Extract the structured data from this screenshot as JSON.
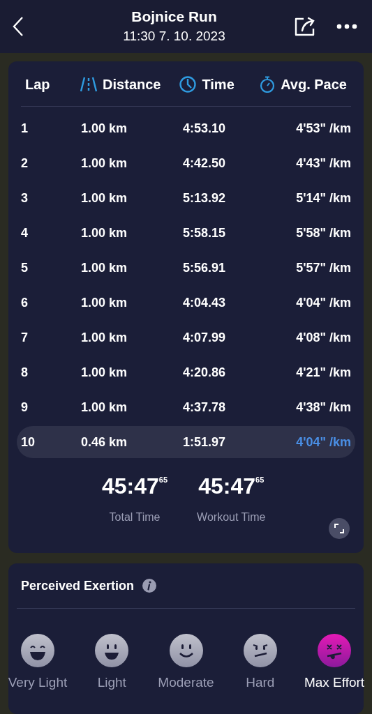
{
  "header": {
    "title": "Bojnice Run",
    "subtitle": "11:30 7. 10. 2023"
  },
  "laps": {
    "columns": [
      {
        "label": "Lap",
        "kind": "plain"
      },
      {
        "label": "Distance",
        "kind": "road"
      },
      {
        "label": "Time",
        "kind": "clock"
      },
      {
        "label": "Avg. Pace",
        "kind": "stopwatch"
      }
    ],
    "rows": [
      {
        "lap": "1",
        "distance": "1.00 km",
        "time": "4:53.10",
        "pace": "4'53\" /km",
        "selected": false
      },
      {
        "lap": "2",
        "distance": "1.00 km",
        "time": "4:42.50",
        "pace": "4'43\" /km",
        "selected": false
      },
      {
        "lap": "3",
        "distance": "1.00 km",
        "time": "5:13.92",
        "pace": "5'14\" /km",
        "selected": false
      },
      {
        "lap": "4",
        "distance": "1.00 km",
        "time": "5:58.15",
        "pace": "5'58\" /km",
        "selected": false
      },
      {
        "lap": "5",
        "distance": "1.00 km",
        "time": "5:56.91",
        "pace": "5'57\" /km",
        "selected": false
      },
      {
        "lap": "6",
        "distance": "1.00 km",
        "time": "4:04.43",
        "pace": "4'04\" /km",
        "selected": false
      },
      {
        "lap": "7",
        "distance": "1.00 km",
        "time": "4:07.99",
        "pace": "4'08\" /km",
        "selected": false
      },
      {
        "lap": "8",
        "distance": "1.00 km",
        "time": "4:20.86",
        "pace": "4'21\" /km",
        "selected": false
      },
      {
        "lap": "9",
        "distance": "1.00 km",
        "time": "4:37.78",
        "pace": "4'38\" /km",
        "selected": false
      },
      {
        "lap": "10",
        "distance": "0.46 km",
        "time": "1:51.97",
        "pace": "4'04\" /km",
        "selected": true
      }
    ],
    "totals": [
      {
        "value": "45:47",
        "fraction": "65",
        "label": "Total Time"
      },
      {
        "value": "45:47",
        "fraction": "65",
        "label": "Workout Time"
      }
    ]
  },
  "exertion": {
    "title": "Perceived Exertion",
    "options": [
      {
        "label": "Very Light",
        "kind": "laugh",
        "selected": false
      },
      {
        "label": "Light",
        "kind": "grin",
        "selected": false
      },
      {
        "label": "Moderate",
        "kind": "smile",
        "selected": false
      },
      {
        "label": "Hard",
        "kind": "frown",
        "selected": false
      },
      {
        "label": "Max Effort",
        "kind": "dizzy",
        "selected": true
      }
    ]
  }
}
